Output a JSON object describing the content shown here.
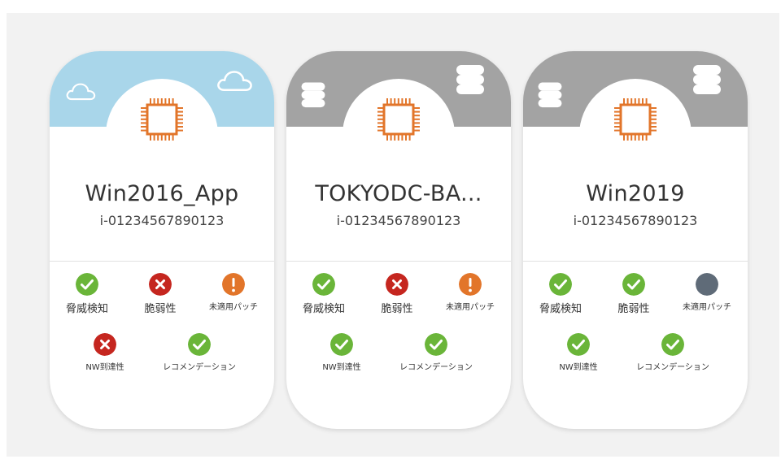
{
  "colors": {
    "ok": "#6ab539",
    "error": "#c5261f",
    "warning": "#e2752a",
    "none": "#5f6b78",
    "chip": "#e2752a",
    "cloud_header": "#a9d6ea",
    "db_header": "#a3a3a3"
  },
  "cards": [
    {
      "header": "cloud-icon",
      "name": "Win2016_App",
      "id": "i-01234567890123",
      "statuses": [
        {
          "label": "脅威検知",
          "state": "ok"
        },
        {
          "label": "脆弱性",
          "state": "error"
        },
        {
          "label": "未適用パッチ",
          "state": "warning"
        },
        {
          "label": "NW到達性",
          "state": "error"
        },
        {
          "label": "レコメンデーション",
          "state": "ok"
        }
      ]
    },
    {
      "header": "database-icon",
      "name": "TOKYODC-BA...",
      "id": "i-01234567890123",
      "statuses": [
        {
          "label": "脅威検知",
          "state": "ok"
        },
        {
          "label": "脆弱性",
          "state": "error"
        },
        {
          "label": "未適用パッチ",
          "state": "warning"
        },
        {
          "label": "NW到達性",
          "state": "ok"
        },
        {
          "label": "レコメンデーション",
          "state": "ok"
        }
      ]
    },
    {
      "header": "database-icon",
      "name": "Win2019",
      "id": "i-01234567890123",
      "statuses": [
        {
          "label": "脅威検知",
          "state": "ok"
        },
        {
          "label": "脆弱性",
          "state": "ok"
        },
        {
          "label": "未適用パッチ",
          "state": "none"
        },
        {
          "label": "NW到達性",
          "state": "ok"
        },
        {
          "label": "レコメンデーション",
          "state": "ok"
        }
      ]
    }
  ]
}
